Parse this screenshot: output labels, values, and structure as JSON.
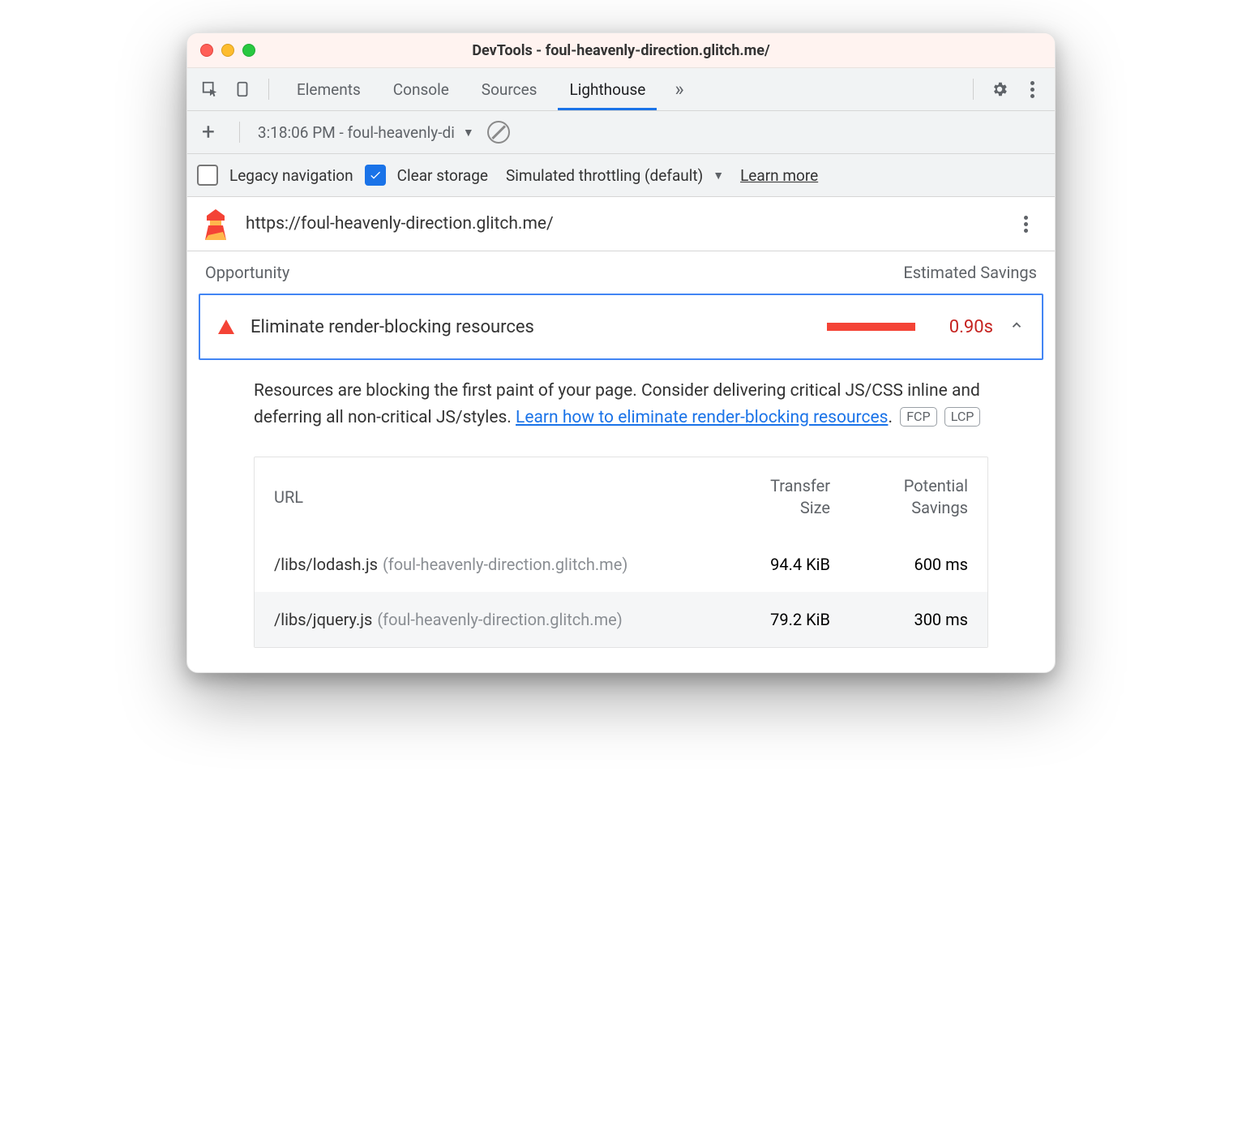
{
  "window": {
    "title": "DevTools - foul-heavenly-direction.glitch.me/"
  },
  "tabs": {
    "items": [
      "Elements",
      "Console",
      "Sources",
      "Lighthouse"
    ],
    "active_index": 3
  },
  "report_selector": {
    "label": "3:18:06 PM - foul-heavenly-di"
  },
  "options": {
    "legacy_label": "Legacy navigation",
    "legacy_checked": false,
    "clear_label": "Clear storage",
    "clear_checked": true,
    "throttling_label": "Simulated throttling (default)",
    "learn_more": "Learn more"
  },
  "report": {
    "url": "https://foul-heavenly-direction.glitch.me/",
    "section_left": "Opportunity",
    "section_right": "Estimated Savings"
  },
  "opportunity": {
    "title": "Eliminate render-blocking resources",
    "value": "0.90s",
    "bar_pct": 95,
    "desc_prefix": "Resources are blocking the first paint of your page. Consider delivering critical JS/CSS inline and deferring all non-critical JS/styles. ",
    "link_text": "Learn how to eliminate render-blocking resources",
    "desc_suffix": ".",
    "badges": [
      "FCP",
      "LCP"
    ]
  },
  "table": {
    "headers": {
      "url": "URL",
      "transfer": "Transfer Size",
      "savings": "Potential Savings"
    },
    "rows": [
      {
        "path": "/libs/lodash.js",
        "host": "(foul-heavenly-direction.glitch.me)",
        "transfer": "94.4 KiB",
        "savings": "600 ms"
      },
      {
        "path": "/libs/jquery.js",
        "host": "(foul-heavenly-direction.glitch.me)",
        "transfer": "79.2 KiB",
        "savings": "300 ms"
      }
    ]
  }
}
